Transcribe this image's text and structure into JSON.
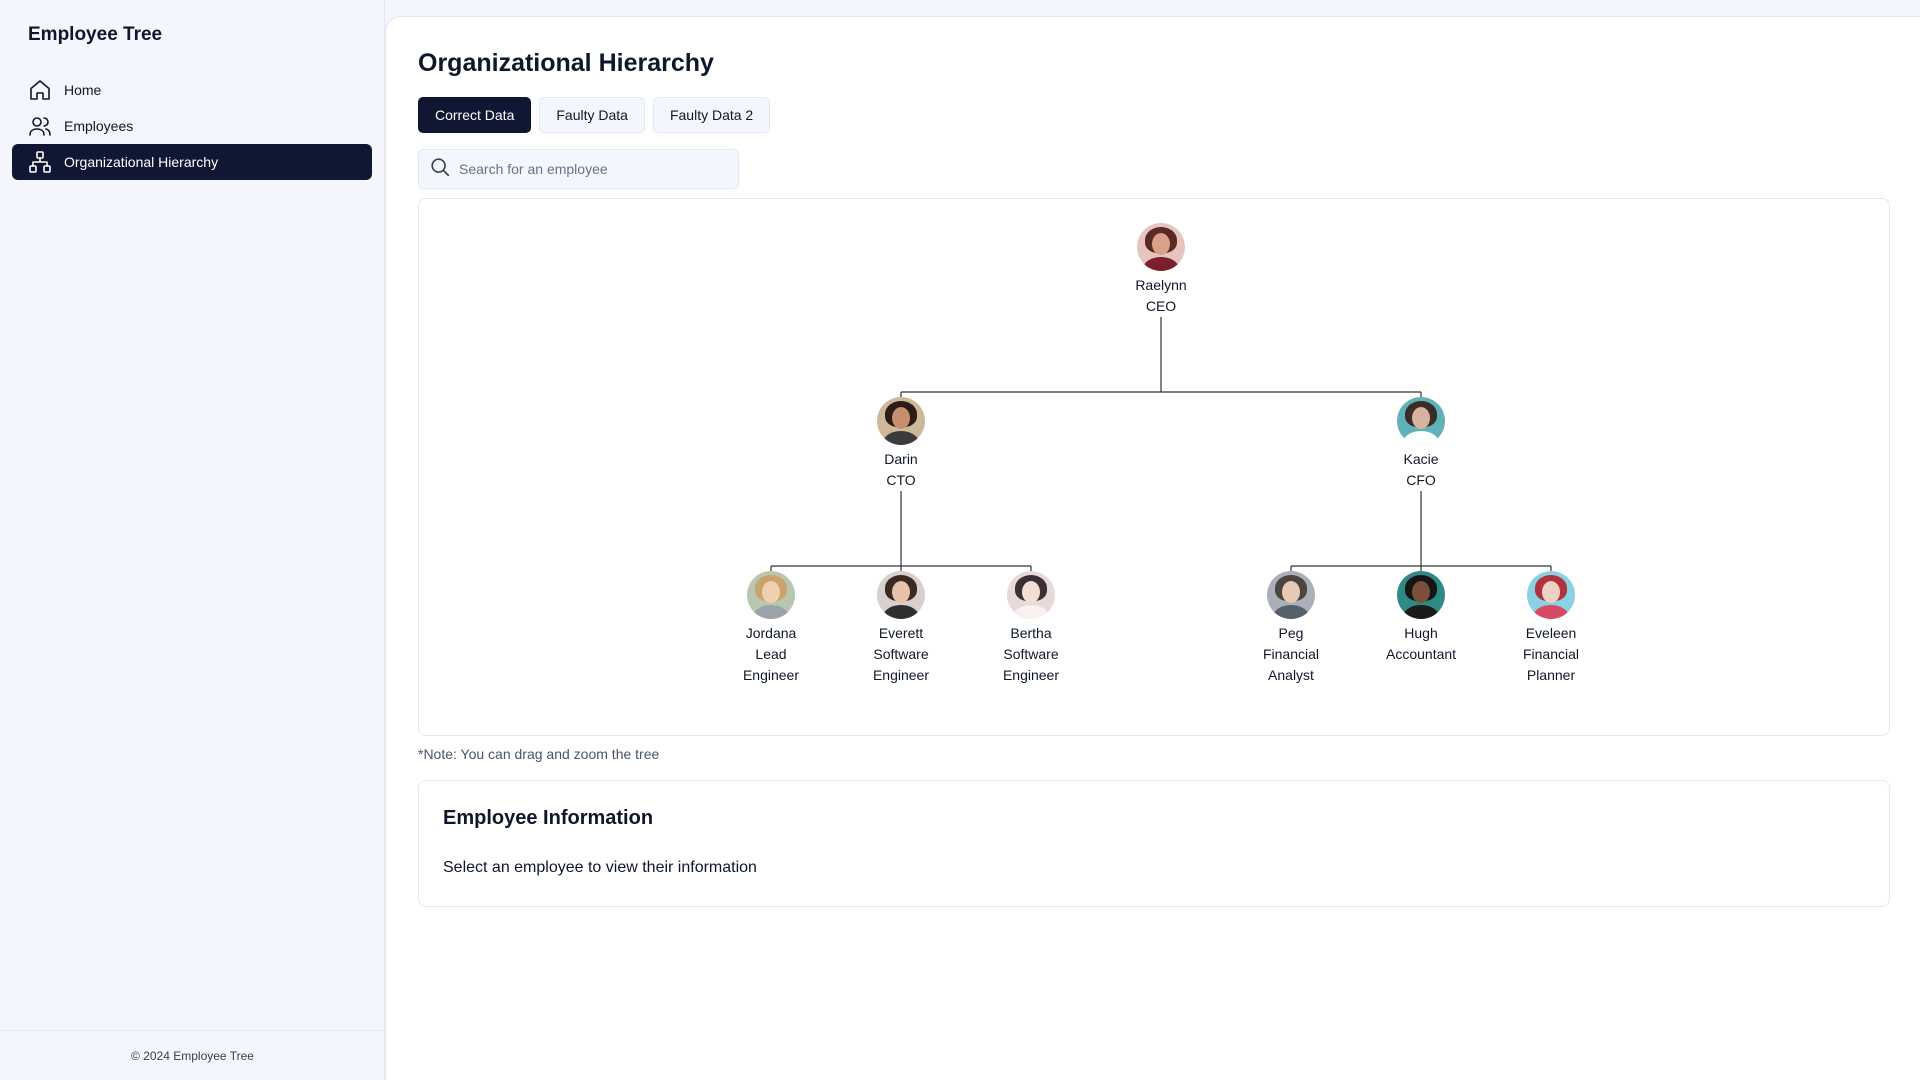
{
  "app": {
    "title": "Employee Tree"
  },
  "sidebar": {
    "items": [
      {
        "label": "Home",
        "icon": "home-icon"
      },
      {
        "label": "Employees",
        "icon": "users-icon"
      },
      {
        "label": "Organizational Hierarchy",
        "icon": "hierarchy-icon",
        "active": true
      }
    ],
    "footer": "© 2024 Employee Tree"
  },
  "main": {
    "title": "Organizational Hierarchy",
    "tabs": [
      {
        "label": "Correct Data",
        "active": true
      },
      {
        "label": "Faulty Data"
      },
      {
        "label": "Faulty Data 2"
      }
    ],
    "search": {
      "placeholder": "Search for an employee",
      "value": ""
    },
    "tree": {
      "root": {
        "name": "Raelynn",
        "title": "CEO",
        "children": [
          {
            "name": "Darin",
            "title": "CTO",
            "children": [
              {
                "name": "Jordana",
                "title": "Lead Engineer"
              },
              {
                "name": "Everett",
                "title": "Software Engineer"
              },
              {
                "name": "Bertha",
                "title": "Software Engineer"
              }
            ]
          },
          {
            "name": "Kacie",
            "title": "CFO",
            "children": [
              {
                "name": "Peg",
                "title": "Financial Analyst"
              },
              {
                "name": "Hugh",
                "title": "Accountant"
              },
              {
                "name": "Eveleen",
                "title": "Financial Planner"
              }
            ]
          }
        ]
      }
    },
    "note": "*Note: You can drag and zoom the tree",
    "info": {
      "title": "Employee Information",
      "text": "Select an employee to view their information"
    }
  },
  "colors": {
    "accent": "#0f1733",
    "background": "#f3f6fc",
    "border": "#e2e8f0"
  }
}
